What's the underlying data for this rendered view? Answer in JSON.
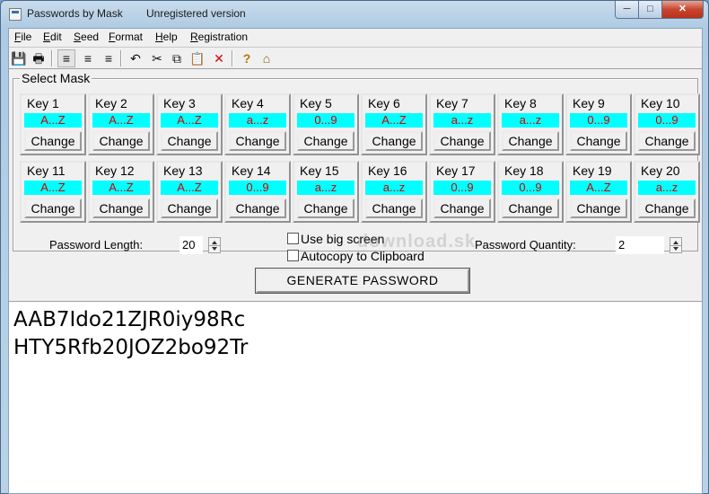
{
  "window": {
    "title": "Passwords by Mask",
    "subtitle": "Unregistered version",
    "controls": {
      "minimize": "─",
      "maximize": "□",
      "close": "✕"
    }
  },
  "menu": [
    "File",
    "Edit",
    "Seed",
    "Format",
    "Help",
    "Registration"
  ],
  "toolbar": [
    {
      "icon": "save-icon",
      "glyph": "💾"
    },
    {
      "icon": "print-icon",
      "glyph": "🖶"
    },
    {
      "icon": "align-left-icon",
      "glyph": "≡"
    },
    {
      "icon": "align-center-icon",
      "glyph": "≡"
    },
    {
      "icon": "align-right-icon",
      "glyph": "≡"
    },
    {
      "icon": "undo-icon",
      "glyph": "↶"
    },
    {
      "icon": "cut-icon",
      "glyph": "✂"
    },
    {
      "icon": "copy-icon",
      "glyph": "⧉"
    },
    {
      "icon": "paste-icon",
      "glyph": "📋"
    },
    {
      "icon": "delete-icon",
      "glyph": "✕"
    },
    {
      "icon": "help-icon",
      "glyph": "?"
    },
    {
      "icon": "home-icon",
      "glyph": "⌂"
    }
  ],
  "mask": {
    "group_label": "Select Mask",
    "change_label": "Change",
    "keys": [
      {
        "label": "Key 1",
        "mask": "A...Z"
      },
      {
        "label": "Key 2",
        "mask": "A...Z"
      },
      {
        "label": "Key 3",
        "mask": "A...Z"
      },
      {
        "label": "Key 4",
        "mask": "a...z"
      },
      {
        "label": "Key 5",
        "mask": "0...9"
      },
      {
        "label": "Key 6",
        "mask": "A...Z"
      },
      {
        "label": "Key 7",
        "mask": "a...z"
      },
      {
        "label": "Key 8",
        "mask": "a...z"
      },
      {
        "label": "Key 9",
        "mask": "0...9"
      },
      {
        "label": "Key 10",
        "mask": "0...9"
      },
      {
        "label": "Key 11",
        "mask": "A...Z"
      },
      {
        "label": "Key 12",
        "mask": "A...Z"
      },
      {
        "label": "Key 13",
        "mask": "A...Z"
      },
      {
        "label": "Key 14",
        "mask": "0...9"
      },
      {
        "label": "Key 15",
        "mask": "a...z"
      },
      {
        "label": "Key 16",
        "mask": "a...z"
      },
      {
        "label": "Key 17",
        "mask": "0...9"
      },
      {
        "label": "Key 18",
        "mask": "0...9"
      },
      {
        "label": "Key 19",
        "mask": "A...Z"
      },
      {
        "label": "Key 20",
        "mask": "a...z"
      }
    ]
  },
  "settings": {
    "length_label": "Password Length:",
    "length_value": "20",
    "quantity_label": "Password Quantity:",
    "quantity_value": "2",
    "big_screen_label": "Use big screen",
    "autocopy_label": "Autocopy to Clipboard",
    "generate_label": "GENERATE PASSWORD"
  },
  "output": {
    "passwords": [
      "AAB7Ido21ZJR0iy98Rc",
      "HTY5Rfb20JOZ2bo92Tr"
    ]
  },
  "watermark": "download.sk"
}
